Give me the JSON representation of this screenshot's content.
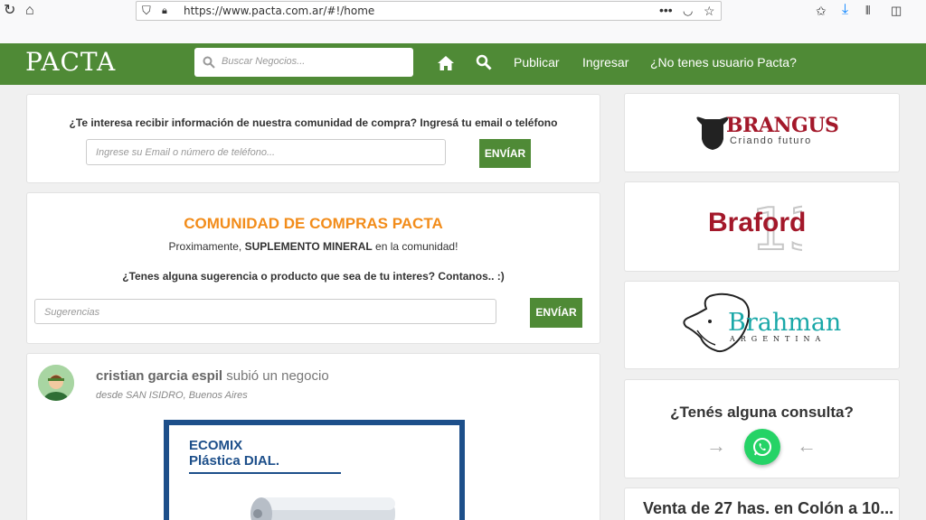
{
  "browser": {
    "url": "https://www.pacta.com.ar/#!/home",
    "icons": [
      "reload-icon",
      "home-icon",
      "shield-icon",
      "lock-icon",
      "more-icon",
      "pocket-icon",
      "star-icon",
      "bookmark-icon",
      "download-icon",
      "library-icon",
      "sidebar-icon"
    ]
  },
  "header": {
    "logo": "PACTA",
    "search_placeholder": "Buscar Negocios...",
    "links": [
      "Publicar",
      "Ingresar",
      "¿No tenes usuario Pacta?"
    ]
  },
  "newsletter": {
    "prompt": "¿Te interesa recibir información de nuestra comunidad de compra? Ingresá tu email o teléfono",
    "placeholder": "Ingrese su Email o número de teléfono...",
    "button": "ENVÍAR"
  },
  "community": {
    "title": "COMUNIDAD DE COMPRAS PACTA",
    "line_pre": "Proximamente, ",
    "line_bold": "SUPLEMENTO MINERAL",
    "line_post": " en la comunidad!",
    "question": "¿Tenes alguna sugerencia o producto que sea de tu interes? Contanos.. :)",
    "placeholder": "Sugerencias",
    "button": "ENVÍAR"
  },
  "post": {
    "author": "cristian garcia espil",
    "action": " subió un negocio",
    "location": "desde SAN ISIDRO, Buenos Aires",
    "image_title_1": "ECOMIX",
    "image_title_2": "Plástica DIAL."
  },
  "sidebar": {
    "brangus": {
      "name": "BRANGUS",
      "tagline": "Criando futuro"
    },
    "braford": {
      "name": "Braford"
    },
    "brahman": {
      "name": "Brahman",
      "tagline": "ARGENTINA"
    },
    "consulta": "¿Tenés alguna consulta?",
    "listing": "Venta de 27 has. en Colón a 10..."
  },
  "colors": {
    "primary_green": "#4f8a36",
    "accent_orange": "#f28c1a",
    "brand_red": "#a3182a",
    "brahman_teal": "#1aa8a8",
    "whatsapp": "#25d366"
  }
}
